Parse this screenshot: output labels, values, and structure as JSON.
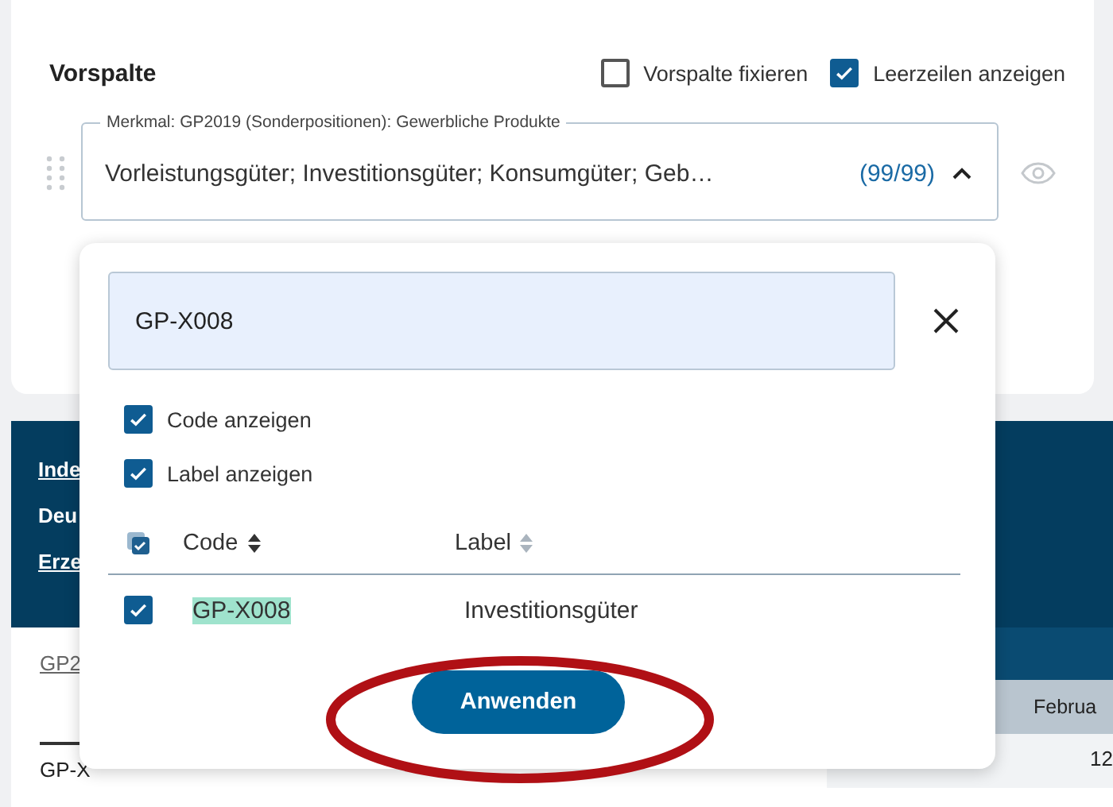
{
  "panel": {
    "title": "Vorspalte",
    "options": [
      {
        "label": "Vorspalte fixieren",
        "checked": false
      },
      {
        "label": "Leerzeilen anzeigen",
        "checked": true
      }
    ],
    "select": {
      "legend": "Merkmal: GP2019 (Sonderpositionen): Gewerbliche Produkte",
      "value": "Vorleistungsgüter; Investitionsgüter; Konsumgüter; Geb…",
      "count": "(99/99)",
      "expanded": true
    }
  },
  "background": {
    "items": [
      {
        "text": "Inde",
        "kind": "link"
      },
      {
        "text": "Deu",
        "kind": "text"
      },
      {
        "text": "Erze",
        "kind": "link"
      }
    ],
    "caption": "GP2",
    "column_header": "Februa",
    "rows": [
      {
        "column_1": "GP-X",
        "column_2": "12"
      }
    ]
  },
  "popup": {
    "search": "GP-X008",
    "toggles": [
      {
        "label": "Code anzeigen",
        "checked": true
      },
      {
        "label": "Label anzeigen",
        "checked": true
      }
    ],
    "select_all": {
      "checked": true,
      "indeterminate": true
    },
    "columns": [
      {
        "label": "Code",
        "sorted": true
      },
      {
        "label": "Label",
        "sorted": false
      }
    ],
    "rows": [
      {
        "code": "GP-X008",
        "label": "Investitionsgüter",
        "checked": true,
        "match": true
      }
    ],
    "apply": "Anwenden"
  }
}
